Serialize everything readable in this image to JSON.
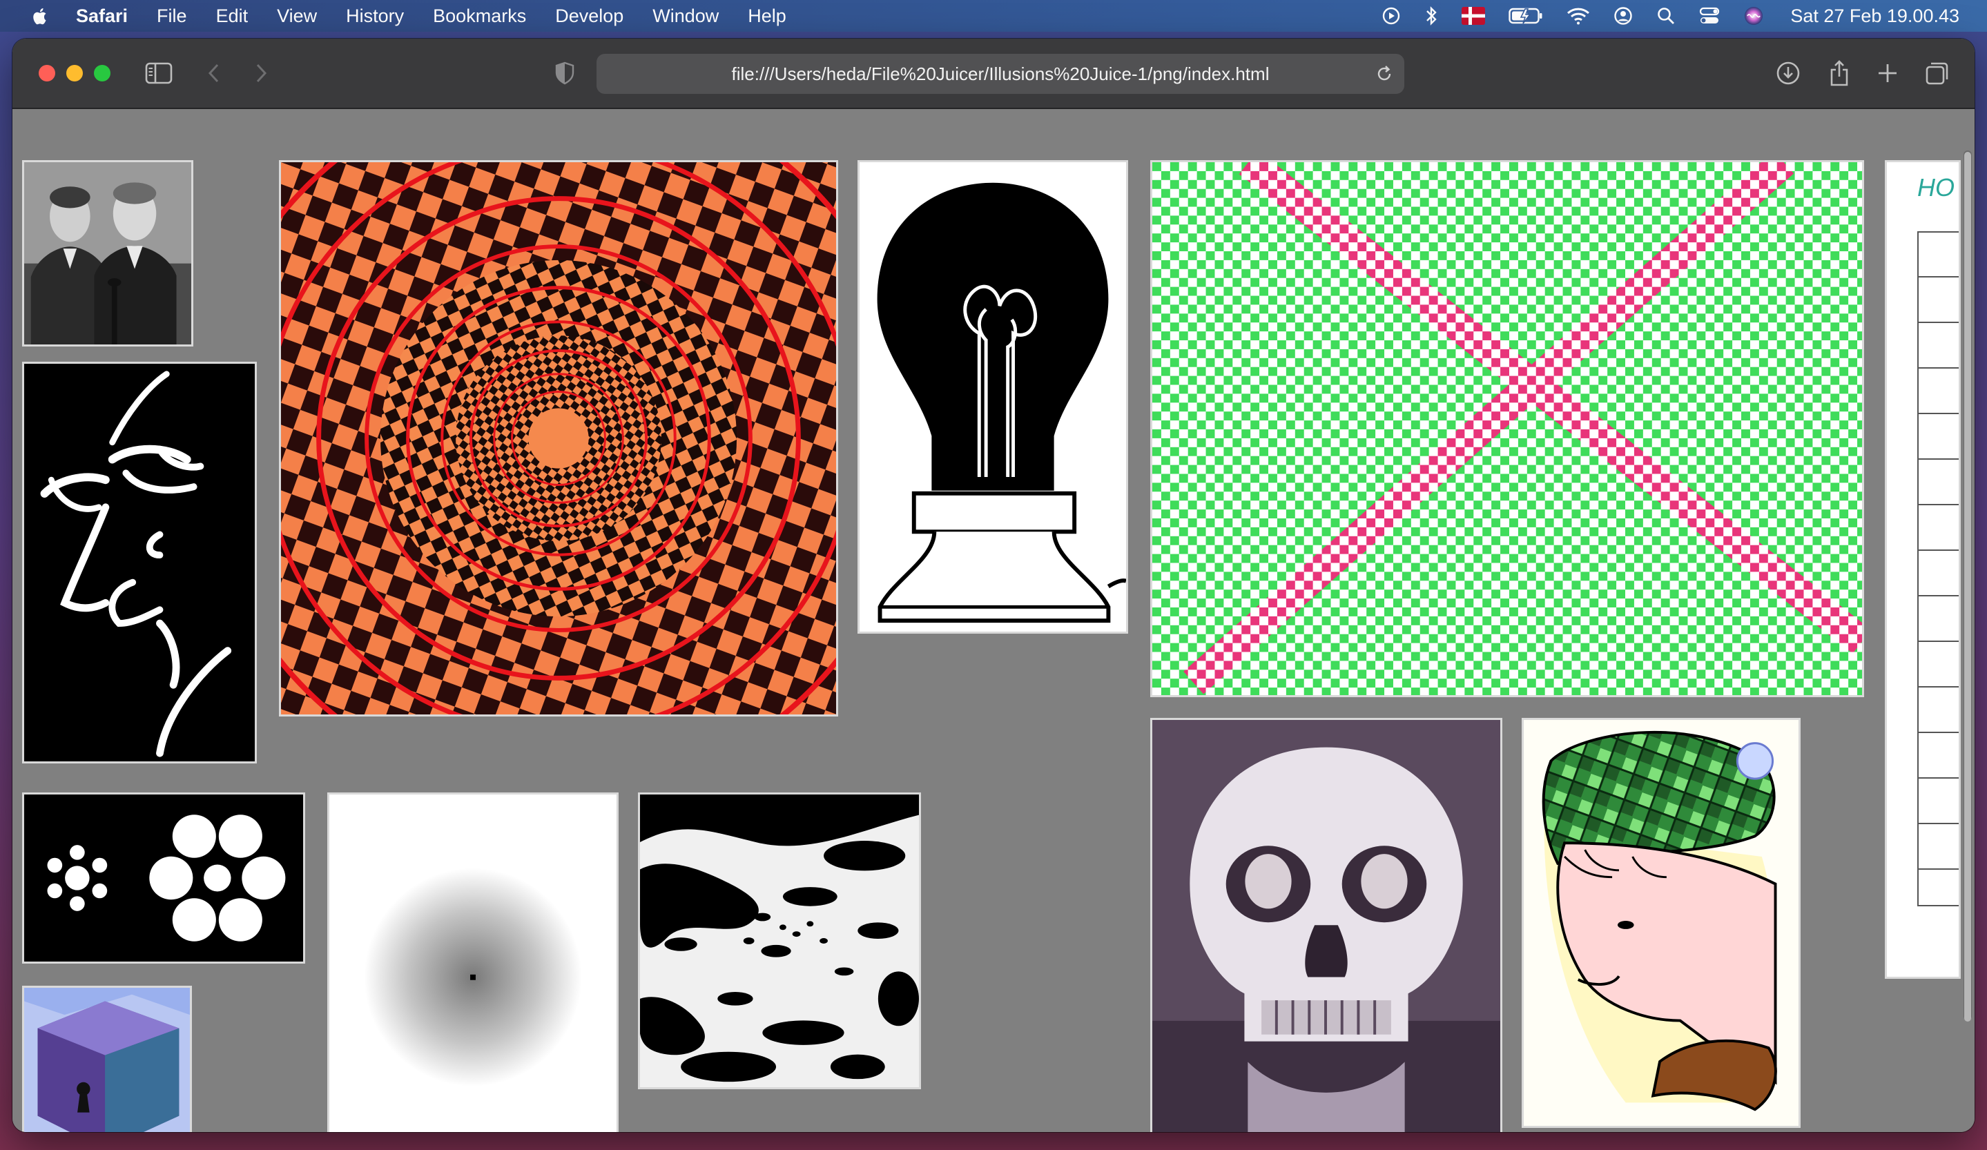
{
  "menubar": {
    "app_name": "Safari",
    "menus": [
      "File",
      "Edit",
      "View",
      "History",
      "Bookmarks",
      "Develop",
      "Window",
      "Help"
    ],
    "clock": "Sat 27 Feb  19.00.43",
    "status_icons": [
      "play-icon",
      "bluetooth-icon",
      "flag-denmark-icon",
      "battery-icon",
      "wifi-icon",
      "user-icon",
      "search-icon",
      "control-center-icon",
      "siri-icon"
    ]
  },
  "toolbar": {
    "url": "file:///Users/heda/File%20Juicer/Illusions%20Juice-1/png/index.html"
  },
  "page": {
    "panel_text": "HO"
  },
  "images": [
    {
      "name": "photo-two-men"
    },
    {
      "name": "face-line-art"
    },
    {
      "name": "ebbinghaus-circles"
    },
    {
      "name": "cube-room-keyhole"
    },
    {
      "name": "radial-spiral-orange"
    },
    {
      "name": "gradient-blur-dot"
    },
    {
      "name": "dalmatian-dog"
    },
    {
      "name": "lightbulb-silhouette"
    },
    {
      "name": "checkerboard-x-green"
    },
    {
      "name": "skull-illusion"
    },
    {
      "name": "hat-face-illusion"
    }
  ],
  "colors": {
    "spiral_orange": "#f5894d",
    "spiral_red": "#e8141c",
    "checker_green": "#3fdc5a",
    "checker_pink": "#e8357a",
    "panel_teal": "#2aa79a"
  }
}
